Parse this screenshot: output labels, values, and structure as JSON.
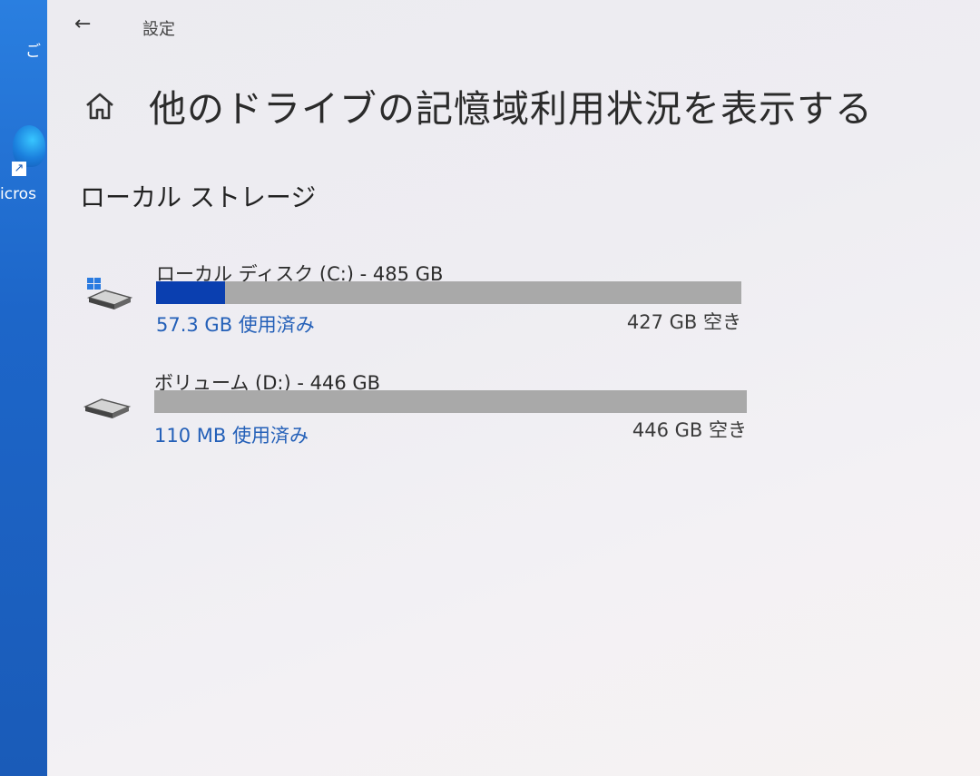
{
  "desktop": {
    "top_text": "ご",
    "icon_label": "icros"
  },
  "titlebar": {
    "back": "←",
    "title": "設定"
  },
  "page": {
    "title": "他のドライブの記憶域利用状況を表示する"
  },
  "section": {
    "title": "ローカル ストレージ"
  },
  "drives": [
    {
      "name": "ローカル ディスク (C:) - 485 GB",
      "used": "57.3 GB 使用済み",
      "free": "427 GB 空き",
      "used_fraction": 0.118,
      "icon": "system-drive-icon"
    },
    {
      "name": "ボリューム (D:) - 446 GB",
      "used": "110 MB 使用済み",
      "free": "446 GB 空き",
      "used_fraction": 0.0,
      "icon": "drive-icon"
    }
  ],
  "colors": {
    "accent_bar": "#0a3fb0",
    "bar_track": "#a9a9a9",
    "used_text": "#2460b8"
  }
}
